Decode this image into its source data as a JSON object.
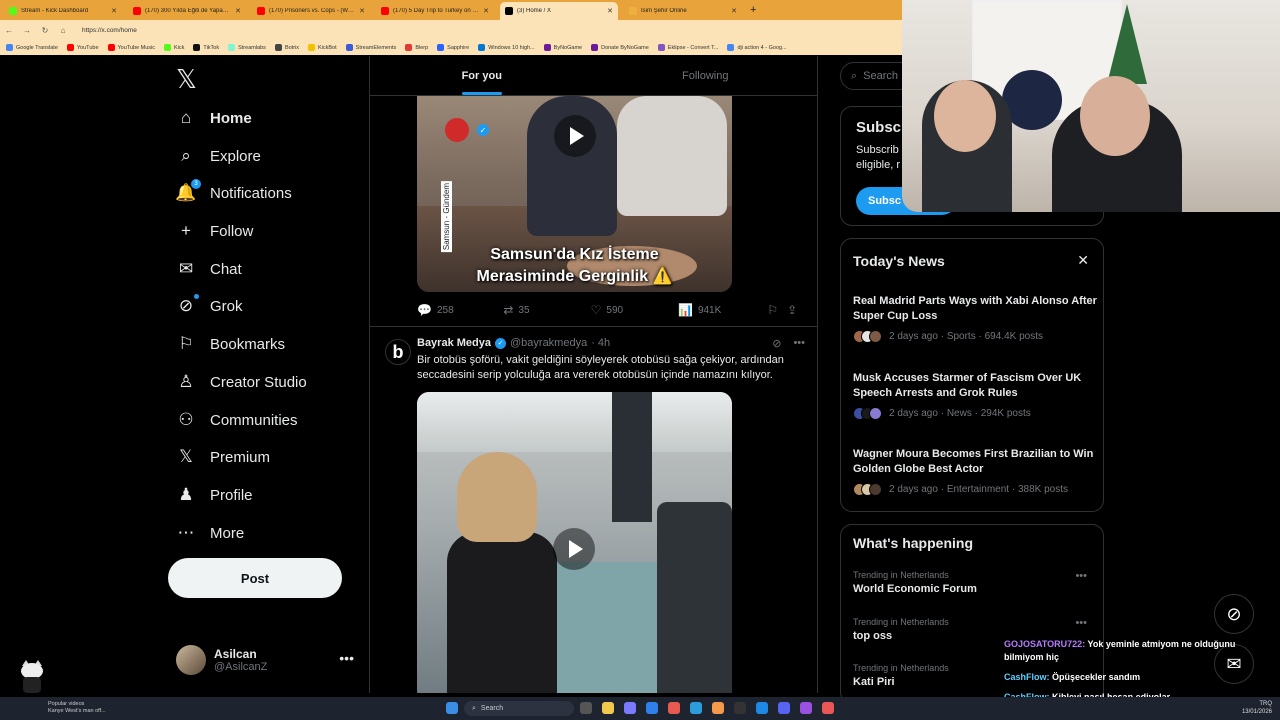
{
  "browser": {
    "tabs": [
      {
        "title": "Stream - Kick Dashboard",
        "color": "#53fc18",
        "active": false
      },
      {
        "title": "(170) 300 Yılda Eğiti de Yapayan Af",
        "color": "#ff0000",
        "active": false
      },
      {
        "title": "(170) Prisoners vs. Cops - (Who's",
        "color": "#ff0000",
        "active": false
      },
      {
        "title": "(170) 5 Day Trip to Turkey on Tun",
        "color": "#ff0000",
        "active": false
      },
      {
        "title": "(3) Home / X",
        "color": "#000000",
        "active": true
      },
      {
        "title": "İsim Şehir Online",
        "color": "#f0b040",
        "active": false
      }
    ],
    "url": "https://x.com/home",
    "bookmarks": [
      {
        "label": "Google Translate",
        "color": "#4285f4"
      },
      {
        "label": "YouTube",
        "color": "#ff0000"
      },
      {
        "label": "YouTube Music",
        "color": "#ff0000"
      },
      {
        "label": "Kick",
        "color": "#53fc18"
      },
      {
        "label": "TikTok",
        "color": "#111111"
      },
      {
        "label": "Streamlabs",
        "color": "#80f5d2"
      },
      {
        "label": "Botrix",
        "color": "#444444"
      },
      {
        "label": "KickBot",
        "color": "#f2c100"
      },
      {
        "label": "StreamElements",
        "color": "#3b5bdb"
      },
      {
        "label": "Blerp",
        "color": "#e53935"
      },
      {
        "label": "Sapphire",
        "color": "#2962ff"
      },
      {
        "label": "Windows 10 high...",
        "color": "#0078d4"
      },
      {
        "label": "ByNoGame",
        "color": "#6a1b9a"
      },
      {
        "label": "Donate ByNoGame",
        "color": "#6a1b9a"
      },
      {
        "label": "Eklipse - Convert T...",
        "color": "#7e57c2"
      },
      {
        "label": "dji action 4 - Goog...",
        "color": "#4285f4"
      }
    ]
  },
  "sidebar": {
    "items": [
      {
        "label": "Home",
        "icon": "home-icon",
        "glyph": "⌂"
      },
      {
        "label": "Explore",
        "icon": "search-icon",
        "glyph": "⌕"
      },
      {
        "label": "Notifications",
        "icon": "bell-icon",
        "glyph": "🔔",
        "badge": "3"
      },
      {
        "label": "Follow",
        "icon": "add-person-icon",
        "glyph": "+"
      },
      {
        "label": "Chat",
        "icon": "mail-icon",
        "glyph": "✉"
      },
      {
        "label": "Grok",
        "icon": "grok-icon",
        "glyph": "⊘"
      },
      {
        "label": "Bookmarks",
        "icon": "bookmark-icon",
        "glyph": "⚐"
      },
      {
        "label": "Creator Studio",
        "icon": "creator-studio-icon",
        "glyph": "♙"
      },
      {
        "label": "Communities",
        "icon": "communities-icon",
        "glyph": "⚇"
      },
      {
        "label": "Premium",
        "icon": "x-logo-icon",
        "glyph": "𝕏"
      },
      {
        "label": "Profile",
        "icon": "person-icon",
        "glyph": "♟"
      },
      {
        "label": "More",
        "icon": "more-circle-icon",
        "glyph": "⋯"
      }
    ],
    "post_label": "Post",
    "profile": {
      "name": "Asilcan",
      "handle": "@AsilcanZ"
    }
  },
  "feed": {
    "tabs": [
      "For you",
      "Following"
    ],
    "post1": {
      "caption_line1": "Samsun'da Kız İsteme",
      "caption_line2": "Merasiminde Gerginlik ⚠️",
      "side_text": "Samsun - Gündem",
      "replies": "258",
      "reposts": "35",
      "likes": "590",
      "views": "941K"
    },
    "post2": {
      "avatar_letter": "b",
      "name": "Bayrak Medya",
      "handle": "@bayrakmedya",
      "time": "· 4h",
      "text": "Bir otobüs şoförü, vakit geldiğini söyleyerek otobüsü sağa çekiyor, ardından seccadesini serip yolculuğa ara vererek otobüsün içinde namazını kılıyor."
    }
  },
  "right": {
    "search_placeholder": "Search",
    "subscribe": {
      "title": "Subscribe",
      "text_line1": "Subscrib",
      "text_line2": "eligible, r",
      "button": "Subsc"
    },
    "news": {
      "title": "Today's News",
      "items": [
        {
          "title": "Real Madrid Parts Ways with Xabi Alonso After Super Cup Loss",
          "meta": "2 days ago · Sports · 694.4K posts"
        },
        {
          "title": "Musk Accuses Starmer of Fascism Over UK Speech Arrests and Grok Rules",
          "meta": "2 days ago · News · 294K posts"
        },
        {
          "title": "Wagner Moura Becomes First Brazilian to Win Golden Globe Best Actor",
          "meta": "2 days ago · Entertainment · 388K posts"
        }
      ]
    },
    "happening": {
      "title": "What's happening",
      "items": [
        {
          "context": "Trending in Netherlands",
          "name": "World Economic Forum"
        },
        {
          "context": "Trending in Netherlands",
          "name": "top oss"
        },
        {
          "context": "Trending in Netherlands",
          "name": "Kati Piri"
        }
      ]
    }
  },
  "chat": [
    {
      "user": "GOJOSATORU722:",
      "msg": "Yok yeminle atmiyom ne olduğunu bilmiyom hiç"
    },
    {
      "user": "CashFlow:",
      "msg": "Öpüşecekler sandım"
    },
    {
      "user": "CashFlow:",
      "msg": "Kibleyi nasıl hesap ediyolar"
    }
  ],
  "taskbar": {
    "search": "Search",
    "left_text1": "Popular videos",
    "left_text2": "Kanye West's man off...",
    "lang": "TRQ",
    "time": "13/01/2026"
  }
}
